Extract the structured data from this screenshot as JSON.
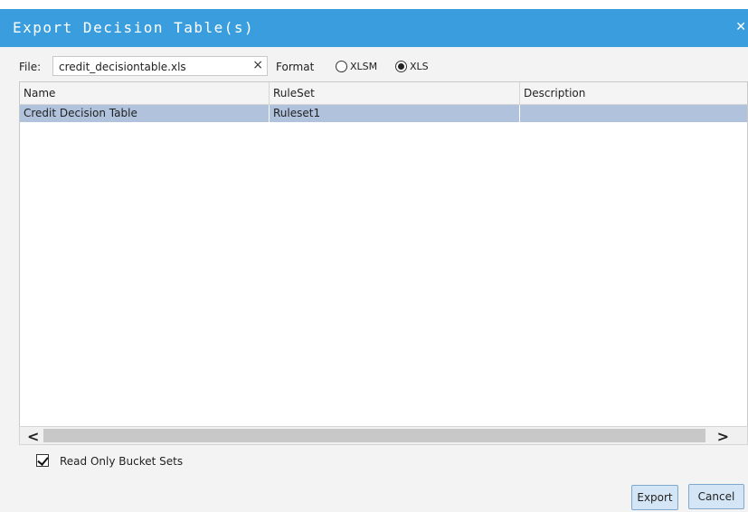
{
  "dialog": {
    "title": "Export Decision Table(s)",
    "close_icon": "close-icon"
  },
  "file": {
    "label": "File:",
    "value": "credit_decisiontable.xls",
    "clear_symbol": "×"
  },
  "format": {
    "label": "Format",
    "options": [
      "XLSM",
      "XLS"
    ],
    "selected": "XLS"
  },
  "table": {
    "columns": [
      "Name",
      "RuleSet",
      "Description"
    ],
    "rows": [
      {
        "name": "Credit Decision Table",
        "ruleset": "Ruleset1",
        "description": ""
      }
    ]
  },
  "scrollbar": {
    "left_arrow": "<",
    "right_arrow": ">"
  },
  "options": {
    "read_only_label": "Read Only Bucket Sets",
    "read_only_checked": true
  },
  "buttons": {
    "export": "Export",
    "cancel": "Cancel"
  },
  "colors": {
    "titlebar": "#3a9ede",
    "selected_row": "#b0c2dc",
    "button": "#d4e6f6"
  }
}
